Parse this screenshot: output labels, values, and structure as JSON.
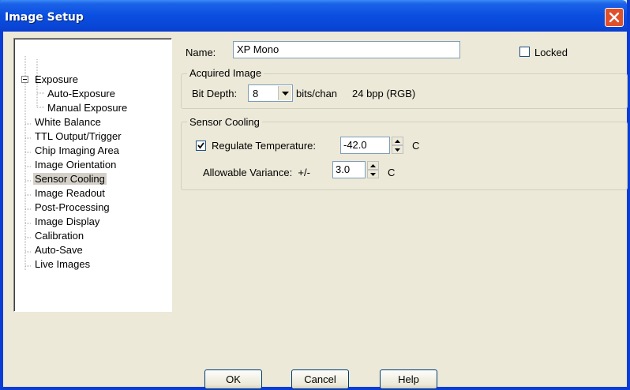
{
  "window": {
    "title": "Image Setup"
  },
  "tree": {
    "items": [
      {
        "label": "Exposure"
      },
      {
        "label": "Auto-Exposure"
      },
      {
        "label": "Manual Exposure"
      },
      {
        "label": "White Balance"
      },
      {
        "label": "TTL Output/Trigger"
      },
      {
        "label": "Chip Imaging Area"
      },
      {
        "label": "Image Orientation"
      },
      {
        "label": "Sensor Cooling"
      },
      {
        "label": "Image Readout"
      },
      {
        "label": "Post-Processing"
      },
      {
        "label": "Image Display"
      },
      {
        "label": "Calibration"
      },
      {
        "label": "Auto-Save"
      },
      {
        "label": "Live Images"
      }
    ],
    "selected_index": 7
  },
  "name": {
    "label": "Name:",
    "value": "XP Mono"
  },
  "locked": {
    "label": "Locked",
    "checked": false
  },
  "acquired": {
    "title": "Acquired Image",
    "bit_depth_label": "Bit Depth:",
    "bit_depth_value": "8",
    "bits_unit": "bits/chan",
    "bpp_text": "24 bpp (RGB)"
  },
  "cooling": {
    "title": "Sensor Cooling",
    "regulate_label": "Regulate Temperature:",
    "regulate_checked": true,
    "temp_value": "-42.0",
    "temp_unit": "C",
    "variance_label": "Allowable Variance:  +/-",
    "variance_value": "3.0",
    "variance_unit": "C"
  },
  "buttons": {
    "ok": "OK",
    "cancel": "Cancel",
    "help": "Help"
  },
  "colors": {
    "titlebar": "#0a4ee0",
    "close": "#e0502a",
    "dialog_bg": "#ece9d8"
  }
}
